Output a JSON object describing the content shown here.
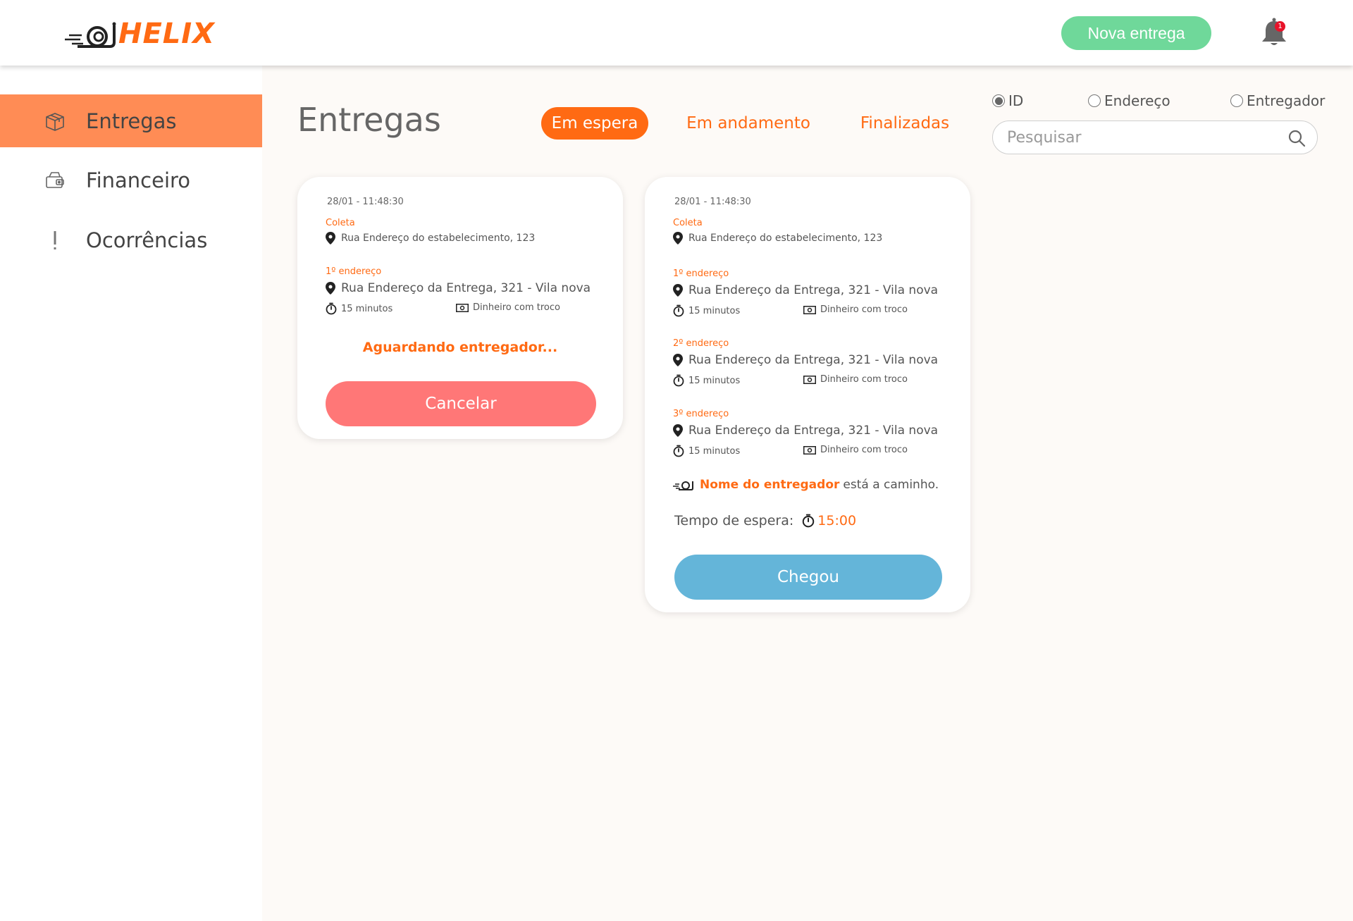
{
  "header": {
    "logo_text": "HELIX",
    "new_delivery_label": "Nova entrega",
    "notification_count": "1"
  },
  "sidebar": {
    "items": [
      {
        "label": "Entregas",
        "icon": "box-icon",
        "active": true
      },
      {
        "label": "Financeiro",
        "icon": "wallet-icon",
        "active": false
      },
      {
        "label": "Ocorrências",
        "icon": "exclamation-icon",
        "active": false
      }
    ]
  },
  "main": {
    "title": "Entregas",
    "tabs": [
      {
        "label": "Em espera",
        "active": true
      },
      {
        "label": "Em andamento",
        "active": false
      },
      {
        "label": "Finalizadas",
        "active": false
      }
    ],
    "filters": [
      {
        "label": "ID",
        "checked": true
      },
      {
        "label": "Endereço",
        "checked": false
      },
      {
        "label": "Entregador",
        "checked": false
      }
    ],
    "search": {
      "placeholder": "Pesquisar",
      "value": ""
    }
  },
  "cards": [
    {
      "timestamp": "28/01 - 11:48:30",
      "pickup_label": "Coleta",
      "pickup_address": "Rua Endereço do estabelecimento, 123",
      "stops": [
        {
          "label": "1º endereço",
          "address": "Rua Endereço da Entrega, 321 - Vila nova",
          "time": "15 minutos",
          "payment": "Dinheiro com troco"
        }
      ],
      "status": "Aguardando entregador...",
      "button_label": "Cancelar"
    },
    {
      "timestamp": "28/01 - 11:48:30",
      "pickup_label": "Coleta",
      "pickup_address": "Rua Endereço do estabelecimento, 123",
      "stops": [
        {
          "label": "1º endereço",
          "address": "Rua Endereço da Entrega, 321 - Vila nova",
          "time": "15 minutos",
          "payment": "Dinheiro com troco"
        },
        {
          "label": "2º endereço",
          "address": "Rua Endereço da Entrega, 321 - Vila nova",
          "time": "15 minutos",
          "payment": "Dinheiro com troco"
        },
        {
          "label": "3º endereço",
          "address": "Rua Endereço da Entrega, 321 - Vila nova",
          "time": "15 minutos",
          "payment": "Dinheiro com troco"
        }
      ],
      "driver_name": "Nome do entregador",
      "driver_status": "está a caminho.",
      "wait_label": "Tempo de espera:",
      "wait_time": "15:00",
      "button_label": "Chegou"
    }
  ],
  "colors": {
    "accent": "#ff6a13",
    "sidebar_active": "#ff8c55",
    "new_button": "#6fd89a",
    "cancel_button": "#ff7777",
    "arrived_button": "#64b5d9",
    "badge": "#e8132a"
  }
}
